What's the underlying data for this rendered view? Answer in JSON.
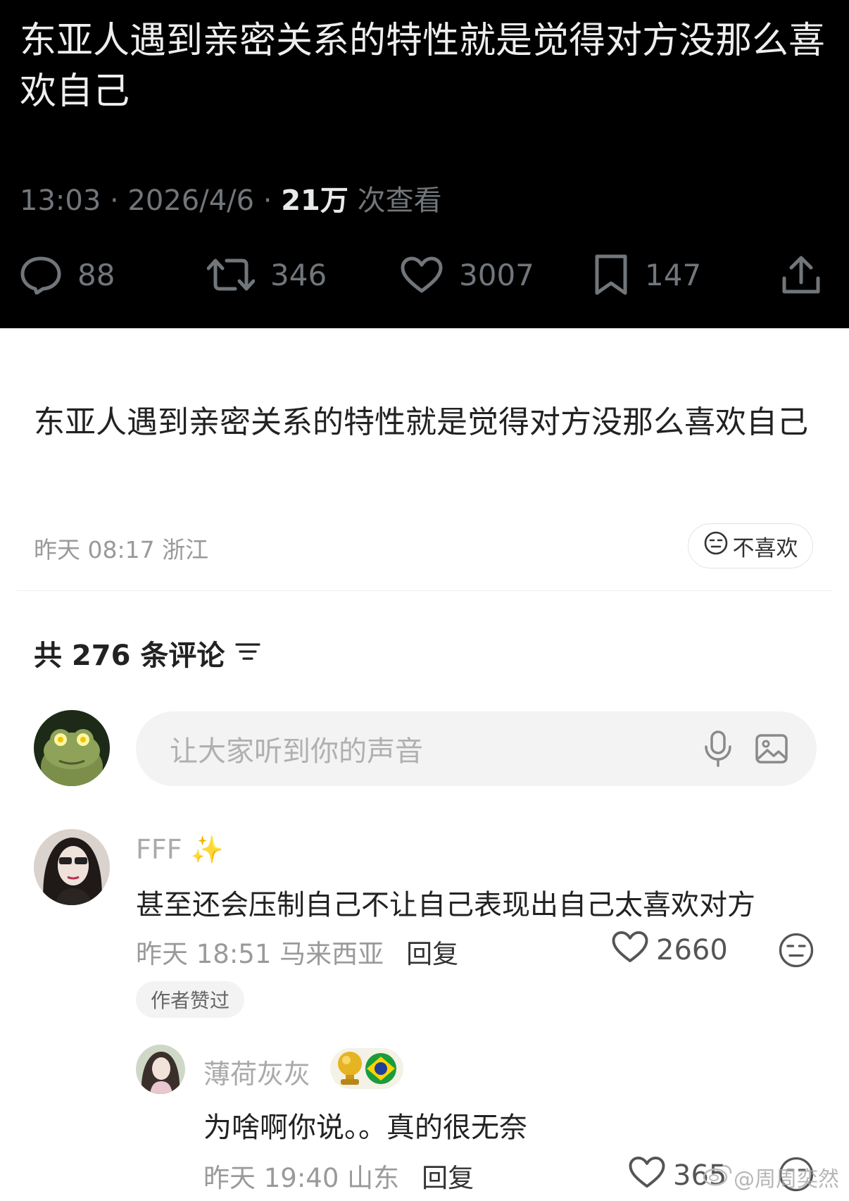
{
  "tweet": {
    "text": "东亚人遇到亲密关系的特性就是觉得对方没那么喜欢自己",
    "time": "13:03 · 2026/4/6 · ",
    "views_number": "21万",
    "views_label": " 次查看",
    "stats": {
      "replies": "88",
      "retweets": "346",
      "likes": "3007",
      "bookmarks": "147"
    }
  },
  "post": {
    "text": "东亚人遇到亲密关系的特性就是觉得对方没那么喜欢自己",
    "meta": "昨天 08:17 浙江",
    "dislike_label": "不喜欢"
  },
  "comments_header": "共 276 条评论",
  "compose": {
    "placeholder": "让大家听到你的声音"
  },
  "comments": [
    {
      "name": "FFF",
      "name_emoji": "✨",
      "text": "甚至还会压制自己不让自己表现出自己太喜欢对方",
      "time": "昨天 18:51 马来西亚",
      "reply_label": "回复",
      "likes": "2660",
      "badge": "作者赞过"
    },
    {
      "name": "薄荷灰灰",
      "text": "为啥啊你说。。真的很无奈",
      "time": "昨天 19:40 山东",
      "reply_label": "回复",
      "likes": "365"
    }
  ],
  "watermark": "@周周奕然",
  "colors": {
    "tweet_bg": "#000000",
    "muted": "#71767b",
    "meta_gray": "#9a9a9a",
    "input_bg": "#f3f3f3"
  },
  "icons": [
    "comment-icon",
    "retweet-icon",
    "heart-icon",
    "bookmark-icon",
    "share-icon",
    "neutral-face-icon",
    "sort-icon",
    "microphone-icon",
    "image-icon",
    "weibo-logo-icon"
  ]
}
